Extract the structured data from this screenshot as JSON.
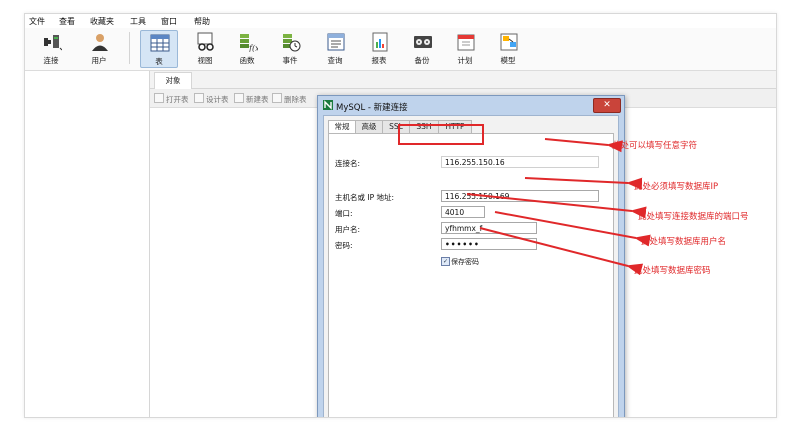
{
  "menu": [
    "文件",
    "查看",
    "收藏夹",
    "工具",
    "窗口",
    "帮助"
  ],
  "toolbar": {
    "buttons": [
      {
        "label": "连接",
        "icon": "plug-icon"
      },
      {
        "label": "用户",
        "icon": "user-icon"
      },
      {
        "label": "表",
        "icon": "table-icon",
        "active": true
      },
      {
        "label": "视图",
        "icon": "view-icon"
      },
      {
        "label": "函数",
        "icon": "function-icon"
      },
      {
        "label": "事件",
        "icon": "event-icon"
      },
      {
        "label": "查询",
        "icon": "query-icon"
      },
      {
        "label": "报表",
        "icon": "report-icon"
      },
      {
        "label": "备份",
        "icon": "backup-icon"
      },
      {
        "label": "计划",
        "icon": "schedule-icon"
      },
      {
        "label": "模型",
        "icon": "model-icon"
      }
    ]
  },
  "object_tab": "对象",
  "object_toolbar": [
    "打开表",
    "设计表",
    "新建表",
    "删除表"
  ],
  "dialog": {
    "title": "MySQL - 新建连接",
    "tabs": [
      "常规",
      "高级",
      "SSL",
      "SSH",
      "HTTP"
    ],
    "fields": {
      "connection_name": {
        "label": "连接名:",
        "value": "116.255.150.16"
      },
      "host": {
        "label": "主机名或 IP 地址:",
        "value": "116.255.150.169"
      },
      "port": {
        "label": "端口:",
        "value": "4010"
      },
      "username": {
        "label": "用户名:",
        "value": "yfhmmx_f"
      },
      "password": {
        "label": "密码:",
        "value": "••••••"
      }
    },
    "save_password": {
      "label": "保存密码",
      "checked": true
    }
  },
  "annotations": {
    "a1": "此处可以填写任意字符",
    "a2": "此处必须填写数据库IP",
    "a3": "此处填写连接数据库的端口号",
    "a4": "此处填写数据库用户名",
    "a5": "此处填写数据库密码"
  },
  "colors": {
    "annotation": "#e0282a",
    "dialog_frame": "#bfd3ec",
    "active_tool": "#d5e5f5"
  }
}
